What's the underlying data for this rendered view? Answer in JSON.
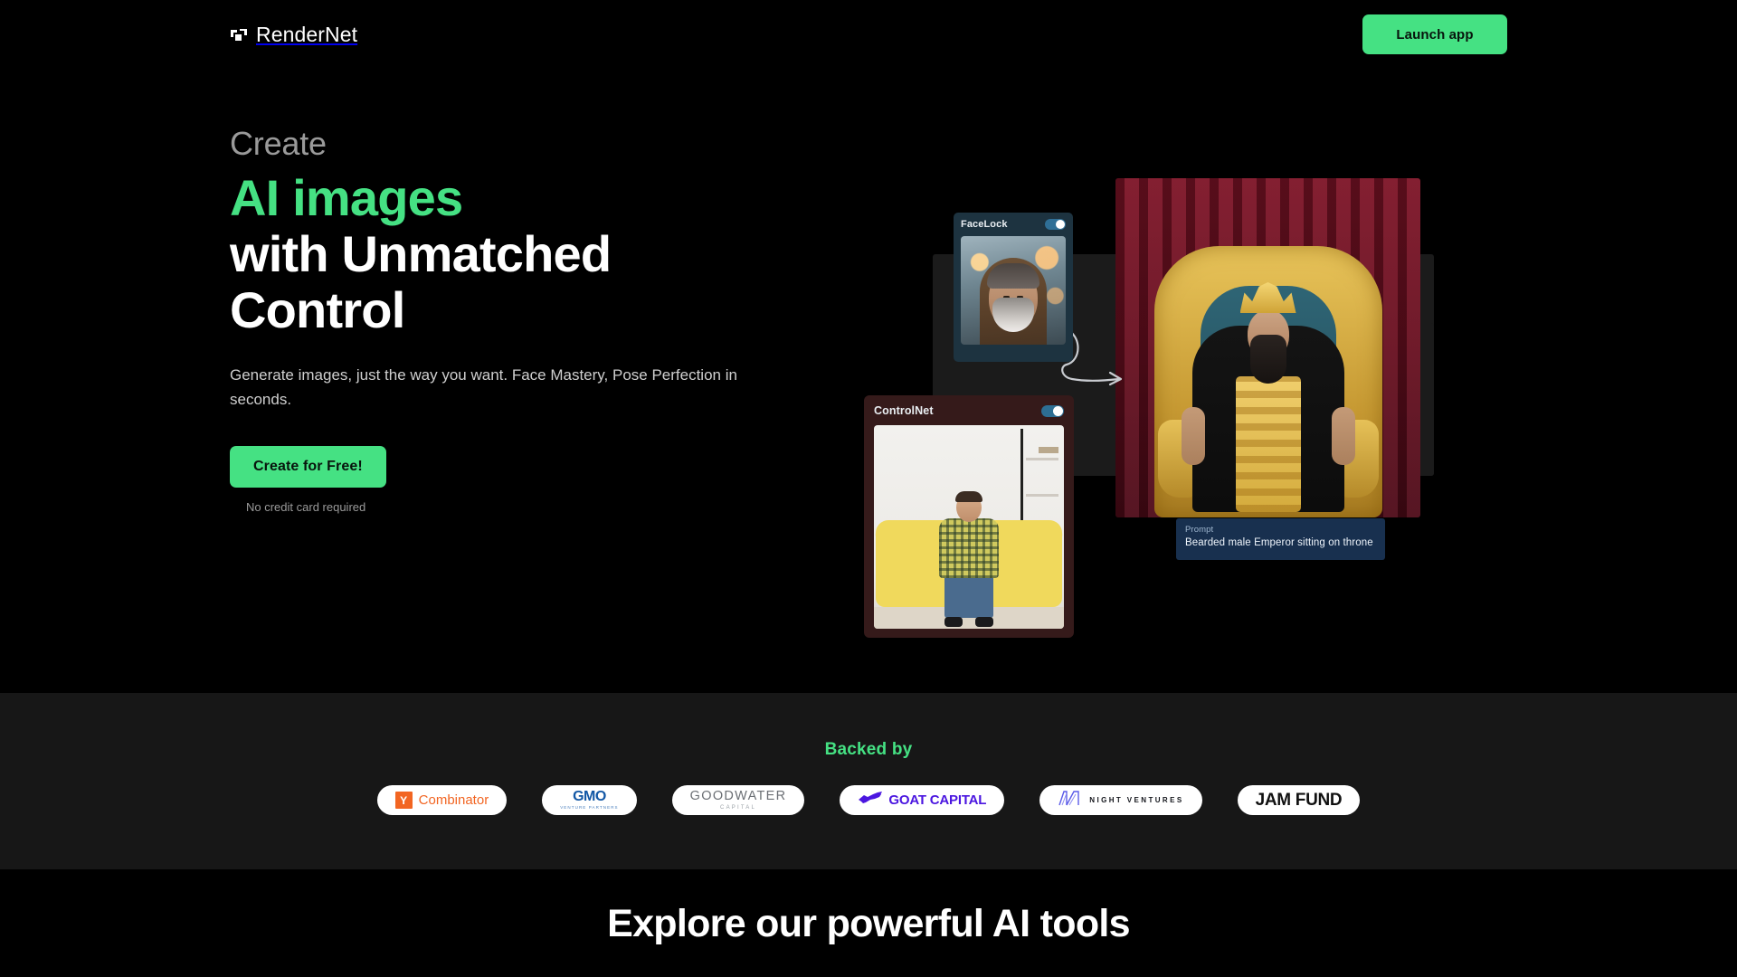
{
  "header": {
    "logo_icon": "rendernet-bracket-icon",
    "brand": "RenderNet",
    "launch_label": "Launch app"
  },
  "hero": {
    "eyebrow": "Create",
    "headline_green": "AI images",
    "headline_line2": "with Unmatched",
    "headline_line3": "Control",
    "subcopy": "Generate images, just the way you want. Face Mastery, Pose Perfection in seconds.",
    "cta_label": "Create for Free!",
    "cta_note": "No credit card required",
    "accent_color": "#45E183",
    "visual": {
      "facelock": {
        "title": "FaceLock",
        "toggle_state": "on"
      },
      "controlnet": {
        "title": "ControlNet",
        "toggle_state": "on"
      },
      "prompt": {
        "label": "Prompt",
        "value": "Bearded male Emperor sitting on throne"
      },
      "connector_icon": "curved-arrow-icon"
    }
  },
  "backed_by": {
    "title": "Backed by",
    "title_color": "#45E183",
    "logos": [
      {
        "name": "Y Combinator",
        "mark": "Y",
        "text": "Combinator",
        "color": "#F26522"
      },
      {
        "name": "GMO Venture Partners",
        "text": "GMO",
        "subtext": "VENTURE PARTNERS",
        "color": "#1257A5"
      },
      {
        "name": "Goodwater Capital",
        "text": "GOODWATER",
        "subtext": "CAPITAL",
        "color": "#6b6f74"
      },
      {
        "name": "GOAT Capital",
        "text": "GOAT CAPITAL",
        "color": "#4B16E0",
        "mark_icon": "goat-icon"
      },
      {
        "name": "Night Ventures",
        "text": "NIGHT VENTURES",
        "color": "#14161c",
        "mark_icon": "night-ventures-n-icon"
      },
      {
        "name": "Jam Fund",
        "text": "JAM FUND",
        "color": "#111111"
      }
    ]
  },
  "tools": {
    "title": "Explore our powerful AI tools"
  }
}
